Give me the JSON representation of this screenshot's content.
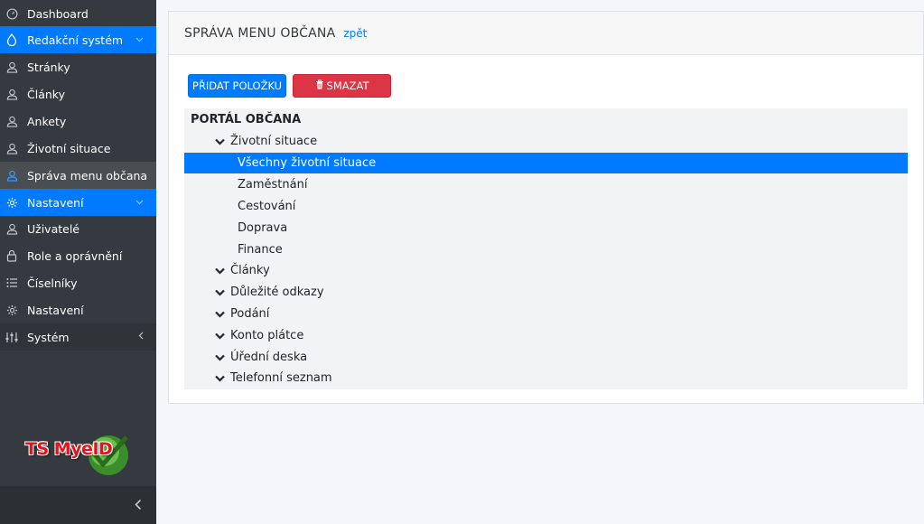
{
  "sidebar": {
    "items": [
      {
        "label": "Dashboard",
        "icon": "dashboard-icon"
      },
      {
        "label": "Redakční systém",
        "icon": "drop-icon"
      },
      {
        "label": "Stránky",
        "icon": "user-icon"
      },
      {
        "label": "Články",
        "icon": "user-icon"
      },
      {
        "label": "Ankety",
        "icon": "user-icon"
      },
      {
        "label": "Životní situace",
        "icon": "user-icon"
      },
      {
        "label": "Správa menu občana",
        "icon": "user-icon"
      },
      {
        "label": "Nastavení",
        "icon": "gear-icon"
      },
      {
        "label": "Uživatelé",
        "icon": "user-icon"
      },
      {
        "label": "Role a oprávnění",
        "icon": "lock-icon"
      },
      {
        "label": "Číselníky",
        "icon": "list-icon"
      },
      {
        "label": "Nastavení",
        "icon": "gear-icon"
      },
      {
        "label": "Systém",
        "icon": "sliders-icon"
      }
    ],
    "logo_text": "TS MyeID"
  },
  "main": {
    "title": "SPRÁVA MENU OBČANA",
    "back_link": "zpět",
    "add_button": "PŘIDAT POLOŽKU",
    "delete_button": "SMAZAT"
  },
  "tree": {
    "root": "PORTÁL OBČANA",
    "nodes": [
      {
        "label": "Životní situace"
      },
      {
        "label": "Všechny životní situace"
      },
      {
        "label": "Zaměstnání"
      },
      {
        "label": "Cestování"
      },
      {
        "label": "Doprava"
      },
      {
        "label": "Finance"
      },
      {
        "label": "Články"
      },
      {
        "label": "Důležité odkazy"
      },
      {
        "label": "Podání"
      },
      {
        "label": "Konto plátce"
      },
      {
        "label": "Úřední deska"
      },
      {
        "label": "Telefonní seznam"
      }
    ]
  },
  "colors": {
    "accent": "#007bff",
    "danger": "#dc3545",
    "sidebar_bg": "#343a40"
  }
}
